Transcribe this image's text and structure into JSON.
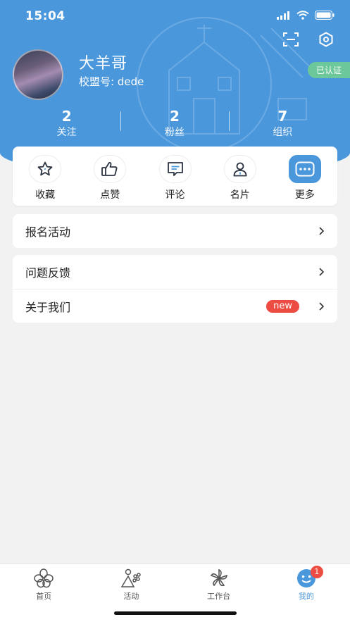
{
  "status_bar": {
    "time": "15:04"
  },
  "profile": {
    "name": "大羊哥",
    "school_id": "校盟号: dede",
    "verified_label": "已认证"
  },
  "stats": [
    {
      "value": "2",
      "label": "关注"
    },
    {
      "value": "2",
      "label": "粉丝"
    },
    {
      "value": "7",
      "label": "组织"
    }
  ],
  "shortcuts": [
    {
      "label": "收藏",
      "icon": "star-icon"
    },
    {
      "label": "点赞",
      "icon": "thumbs-up-icon"
    },
    {
      "label": "评论",
      "icon": "comment-icon"
    },
    {
      "label": "名片",
      "icon": "person-card-icon"
    },
    {
      "label": "更多",
      "icon": "more-icon"
    }
  ],
  "menu_primary": [
    {
      "label": "报名活动"
    }
  ],
  "menu_secondary": [
    {
      "label": "问题反馈"
    },
    {
      "label": "关于我们",
      "badge": "new"
    }
  ],
  "tabbar": [
    {
      "label": "首页",
      "icon": "home-petal-icon"
    },
    {
      "label": "活动",
      "icon": "activity-icon"
    },
    {
      "label": "工作台",
      "icon": "workbench-icon"
    },
    {
      "label": "我的",
      "icon": "smiley-icon",
      "badge": "1",
      "active": true
    }
  ],
  "colors": {
    "primary": "#4a97dc",
    "verified": "#6cc79a",
    "badge": "#ec4c42",
    "background": "#f2f2f3"
  }
}
